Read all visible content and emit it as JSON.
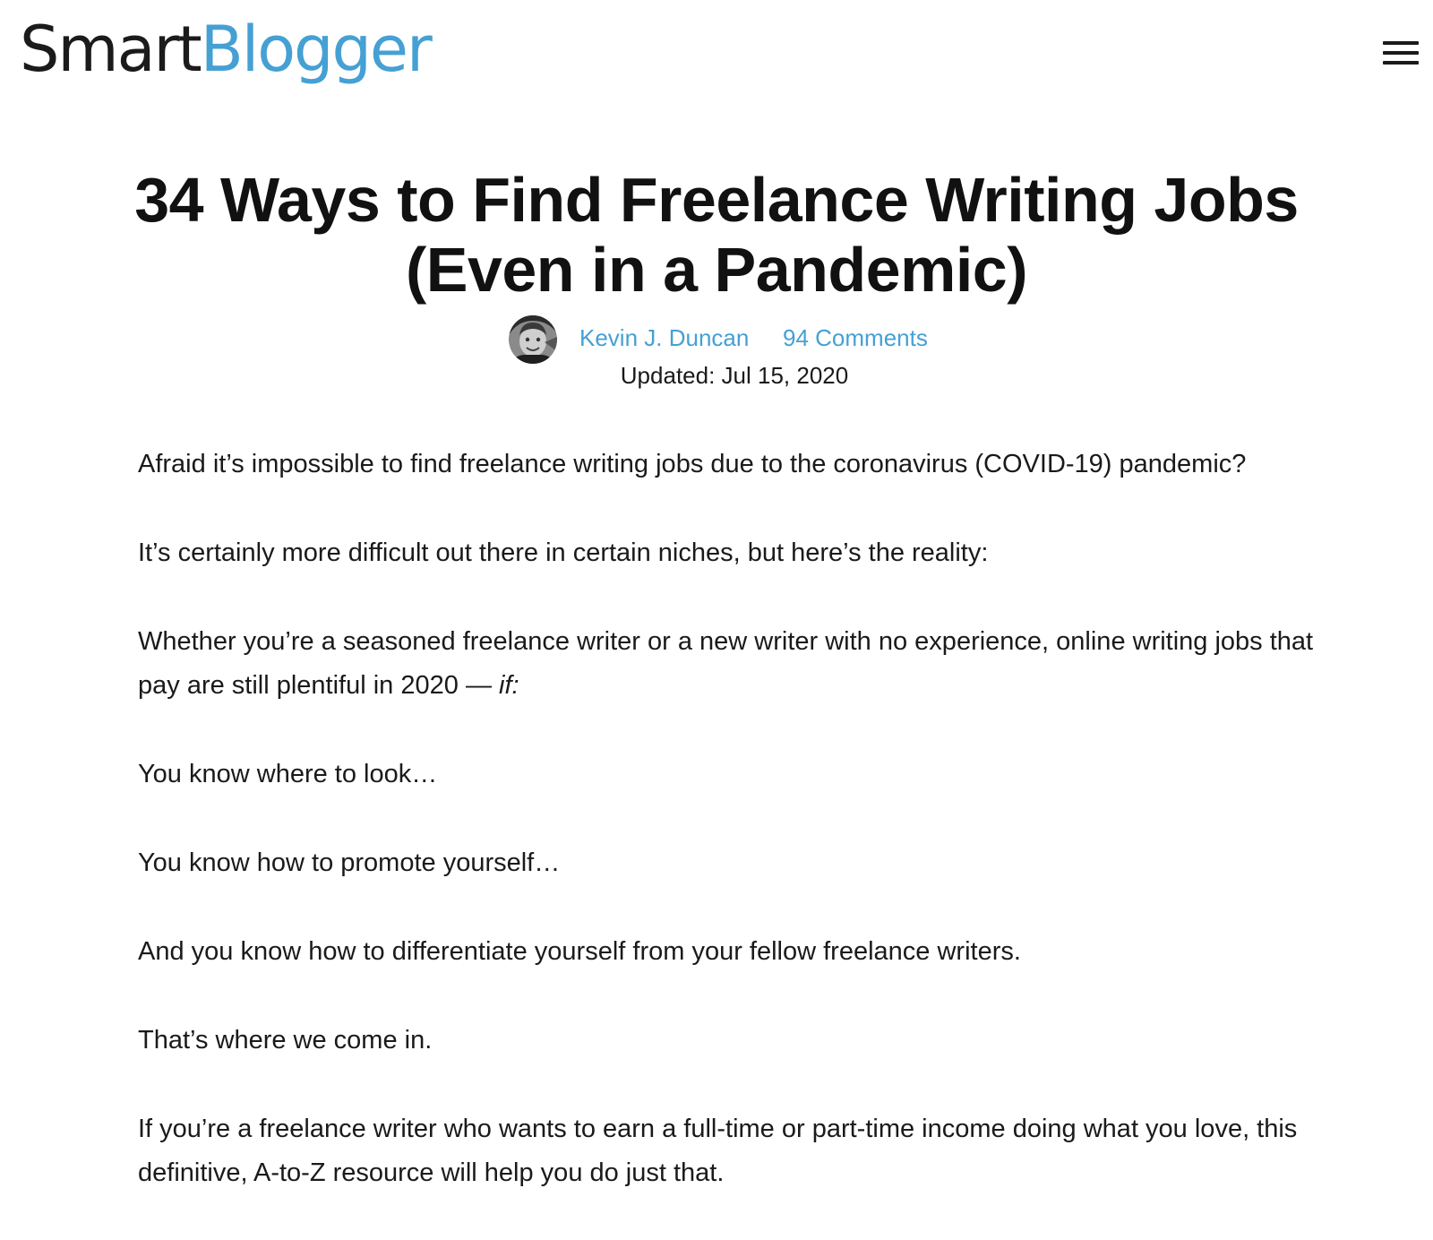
{
  "header": {
    "logo_part1": "Smart",
    "logo_part2": "Blogger",
    "menu_icon": "hamburger-menu-icon"
  },
  "article": {
    "title": "34 Ways to Find Freelance Writing Jobs (Even in a Pandemic)",
    "author": "Kevin J. Duncan",
    "comments": "94 Comments",
    "updated": "Updated: Jul 15, 2020",
    "paragraphs": [
      "Afraid it’s impossible to find freelance writing jobs due to the coronavirus (COVID-19) pandemic?",
      "It’s certainly more difficult out there in certain niches, but here’s the reality:",
      "Whether you’re a seasoned freelance writer or a new writer with no experience, online writing jobs that pay are still plentiful in 2020 —",
      "You know where to look…",
      "You know how to promote yourself…",
      "And you know how to differentiate yourself from your fellow freelance writers.",
      "That’s where we come in.",
      "If you’re a freelance writer who wants to earn a full-time or part-time income doing what you love, this definitive, A-to-Z resource will help you do just that."
    ],
    "paragraph3_emphasis": "if:"
  },
  "colors": {
    "brand_blue": "#45a0d4",
    "text": "#1a1a1a",
    "background": "#ffffff"
  }
}
